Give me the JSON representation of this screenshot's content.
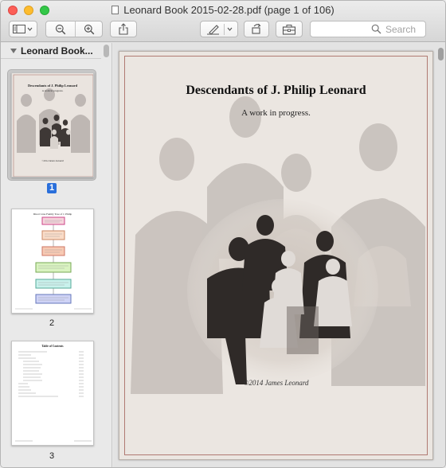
{
  "window": {
    "title": "Leonard Book 2015-02-28.pdf (page 1 of 106)"
  },
  "toolbar": {
    "sidebar_toggle_icon": "sidebar-icon",
    "zoom_out_icon": "zoom-out-icon",
    "zoom_in_icon": "zoom-in-icon",
    "share_icon": "share-icon",
    "markup_icon": "pen-icon",
    "rotate_icon": "rotate-icon",
    "toolbox_icon": "toolbox-icon",
    "search_placeholder": "Search"
  },
  "sidebar": {
    "title": "Leonard Book...",
    "pages": [
      {
        "number": "1",
        "selected": true
      },
      {
        "number": "2",
        "selected": false
      },
      {
        "number": "3",
        "selected": false
      }
    ],
    "thumb1": {
      "heading": "Descendants of J. Philip Leonard",
      "subtitle": "A work in progress.",
      "copyright": "©2014 James Leonard"
    },
    "thumb2": {
      "heading": "Direct Line Family Tree of J. Philip"
    },
    "thumb3": {
      "heading": "Table of Contents"
    }
  },
  "document": {
    "heading": "Descendants of J. Philip Leonard",
    "subtitle": "A work in progress.",
    "copyright": "©2014 James Leonard"
  },
  "colors": {
    "selection_badge": "#2a6fdb",
    "page_border": "#b07a72",
    "close": "#fc5f57",
    "minimize": "#fdbc2e",
    "zoom": "#33c748"
  }
}
